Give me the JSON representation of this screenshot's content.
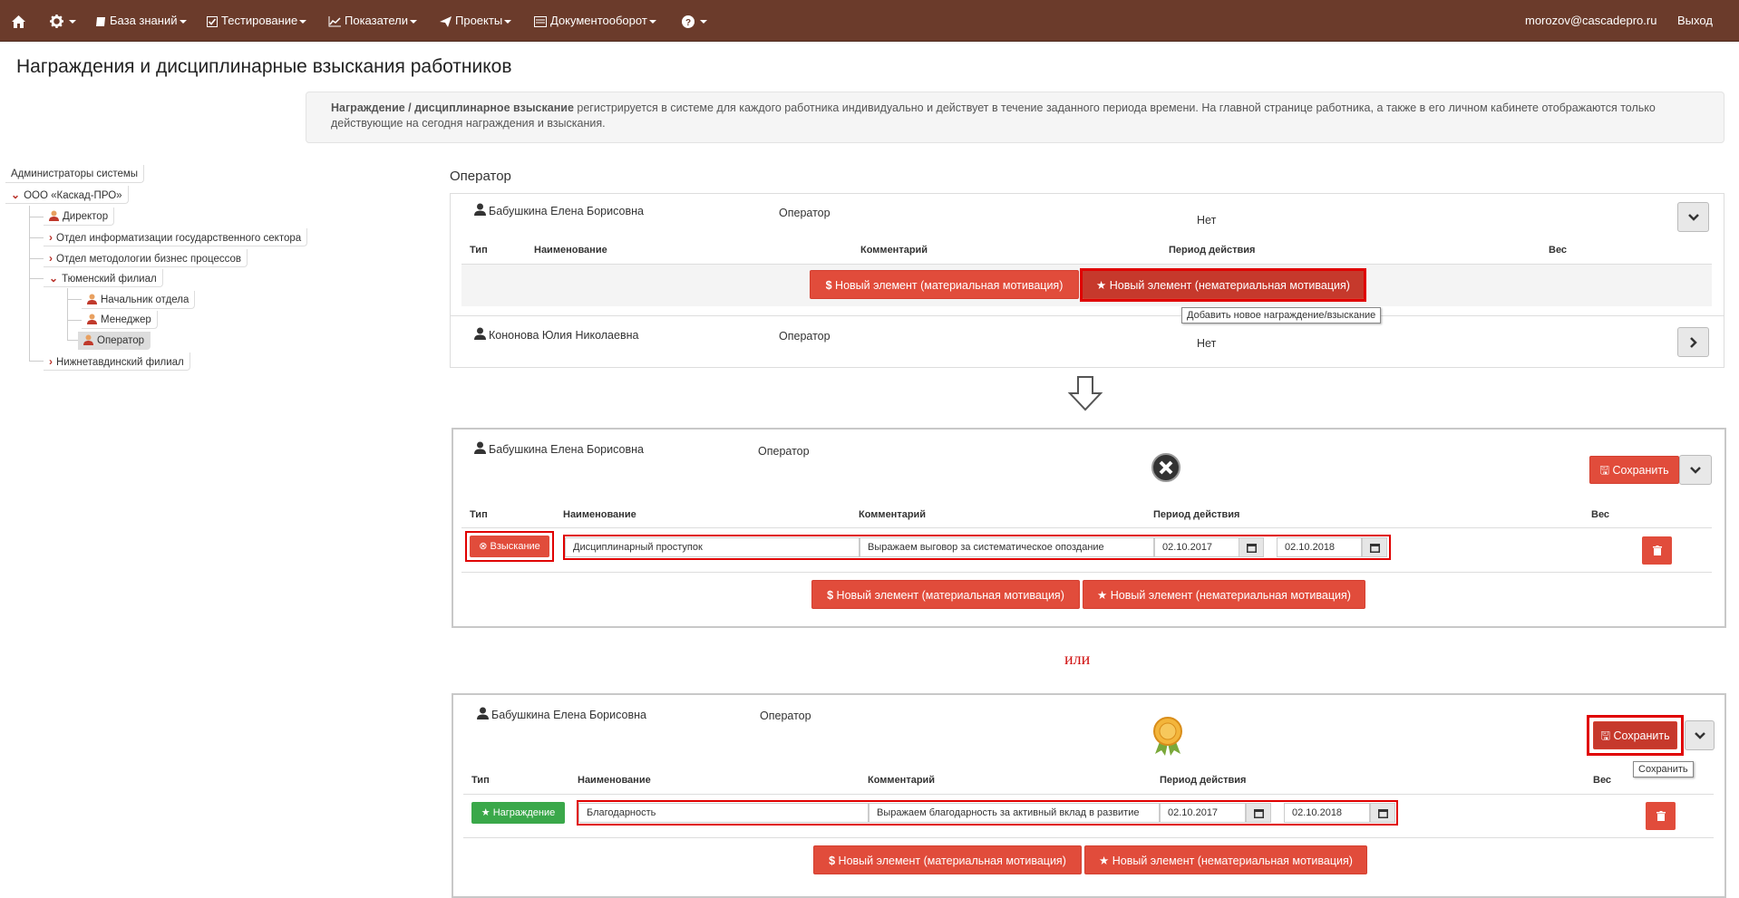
{
  "nav": {
    "home_icon": "home-icon",
    "settings_icon": "gear-icon",
    "items": [
      {
        "label": "База знаний",
        "icon": "book-icon"
      },
      {
        "label": "Тестирование",
        "icon": "check-square-icon"
      },
      {
        "label": "Показатели",
        "icon": "line-chart-icon"
      },
      {
        "label": "Проекты",
        "icon": "paper-plane-icon"
      },
      {
        "label": "Документооборот",
        "icon": "document-icon"
      }
    ],
    "help_icon": "question-circle-icon",
    "user_email": "morozov@cascadepro.ru",
    "logout": "Выход"
  },
  "page": {
    "title": "Награждения и дисциплинарные взыскания работников",
    "info_bold": "Награждение / дисциплинарное взыскание",
    "info_text": " регистрируется в системе для каждого работника индивидуально и действует в течение заданного периода времени. На главной странице работника, а также в его личном кабинете отображаются только действующие на сегодня награждения и взыскания."
  },
  "tree": {
    "admins": "Администраторы системы",
    "org": "ООО «Каскад-ПРО»",
    "director": "Директор",
    "dept1": "Отдел информатизации государственного сектора",
    "dept2": "Отдел методологии бизнес процессов",
    "branch1": "Тюменский филиал",
    "head": "Начальник отдела",
    "manager": "Менеджер",
    "operator": "Оператор",
    "branch2": "Нижнетавдинский филиал"
  },
  "section_title": "Оператор",
  "columns": {
    "type": "Тип",
    "name": "Наименование",
    "comment": "Комментарий",
    "period": "Период действия",
    "weight": "Вес"
  },
  "buttons": {
    "new_material": "Новый элемент (материальная мотивация)",
    "new_nonmaterial": "Новый элемент (нематериальная мотивация)",
    "save": "Сохранить"
  },
  "top_panel": {
    "emp1_name": "Бабушкина Елена Борисовна",
    "emp1_role": "Оператор",
    "emp1_value": "Нет",
    "emp2_name": "Кононова Юлия Николаевна",
    "emp2_role": "Оператор",
    "emp2_value": "Нет",
    "tooltip": "Добавить новое награждение/взыскание"
  },
  "panel_penalty": {
    "emp_name": "Бабушкина Елена Борисовна",
    "emp_role": "Оператор",
    "type_label": "Взыскание",
    "name_value": "Дисциплинарный проступок",
    "comment_value": "Выражаем выговор за систематическое опоздание",
    "date_from": "02.10.2017",
    "date_to": "02.10.2018"
  },
  "or_label": "или",
  "panel_award": {
    "emp_name": "Бабушкина Елена Борисовна",
    "emp_role": "Оператор",
    "type_label": "Награждение",
    "name_value": "Благодарность",
    "comment_value": "Выражаем благодарность за активный вклад в развитие",
    "date_from": "02.10.2017",
    "date_to": "02.10.2018",
    "save_tooltip": "Сохранить"
  },
  "colors": {
    "navbar": "#6b3b2b",
    "red_button": "#e14c3b",
    "green_badge": "#3aa84a",
    "highlight": "#e00000"
  }
}
